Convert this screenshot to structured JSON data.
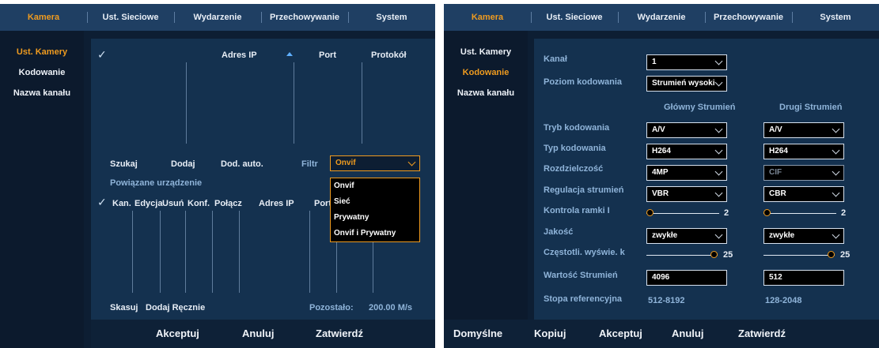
{
  "left": {
    "tabs": [
      "Kamera",
      "Ust. Sieciowe",
      "Wydarzenie",
      "Przechowywanie",
      "System"
    ],
    "sidebar": [
      "Ust. Kamery",
      "Kodowanie",
      "Nazwa kanału"
    ],
    "table1_headers": {
      "ip": "Adres IP",
      "port": "Port",
      "protocol": "Protokół"
    },
    "actions": {
      "search": "Szukaj",
      "add": "Dodaj",
      "auto_add": "Dod. auto.",
      "filter_label": "Filtr"
    },
    "filter": {
      "selected": "Onvif",
      "options": [
        "Onvif",
        "Sieć",
        "Prywatny",
        "Onvif i Prywatny"
      ]
    },
    "linked_title": "Powiązane urządzenie",
    "table2_headers": {
      "ch": "Kan.",
      "edit": "Edycja",
      "delete": "Usuń",
      "conf": "Konf.",
      "connect": "Połącz",
      "ip": "Adres IP",
      "port": "Port"
    },
    "footer": {
      "delete": "Skasuj",
      "manual_add": "Dodaj Ręcznie",
      "remaining_label": "Pozostało:",
      "remaining_value": "200.00 M/s"
    },
    "buttons": {
      "accept": "Akceptuj",
      "cancel": "Anuluj",
      "confirm": "Zatwierdź"
    }
  },
  "right": {
    "tabs": [
      "Kamera",
      "Ust. Sieciowe",
      "Wydarzenie",
      "Przechowywanie",
      "System"
    ],
    "sidebar": [
      "Ust. Kamery",
      "Kodowanie",
      "Nazwa kanału"
    ],
    "channel": {
      "label": "Kanał",
      "value": "1"
    },
    "encode_level": {
      "label": "Poziom kodowania",
      "value": "Strumień wysoki"
    },
    "columns": {
      "main": "Główny Strumień",
      "sub": "Drugi Strumień"
    },
    "rows": {
      "encode_mode": {
        "label": "Tryb kodowania",
        "main": "A/V",
        "sub": "A/V"
      },
      "encode_type": {
        "label": "Typ kodowania",
        "main": "H264",
        "sub": "H264"
      },
      "resolution": {
        "label": "Rozdzielczość",
        "main": "4MP",
        "sub": "CIF"
      },
      "bitrate_ctrl": {
        "label": "Regulacja strumień",
        "main": "VBR",
        "sub": "CBR"
      },
      "frame_ctrl": {
        "label": "Kontrola ramki I",
        "main": "2",
        "sub": "2",
        "main_level": 0,
        "sub_level": 0
      },
      "quality": {
        "label": "Jakość",
        "main": "zwykłe",
        "sub": "zwykłe"
      },
      "fps": {
        "label": "Częstotli. wyświe. k",
        "main": "25",
        "sub": "25",
        "main_level": 1,
        "sub_level": 1
      },
      "bitrate": {
        "label": "Wartość Strumień",
        "main": "4096",
        "sub": "512"
      },
      "ref_rate": {
        "label": "Stopa referencyjna",
        "main": "512-8192",
        "sub": "128-2048"
      }
    },
    "buttons": {
      "default": "Domyślne",
      "copy": "Kopiuj",
      "accept": "Akceptuj",
      "cancel": "Anuluj",
      "confirm": "Zatwierdź"
    }
  },
  "colors": {
    "accent": "#ef9b1f",
    "tabbar": "#1f3f63",
    "panel": "#0d1e33",
    "content": "#14314f"
  }
}
